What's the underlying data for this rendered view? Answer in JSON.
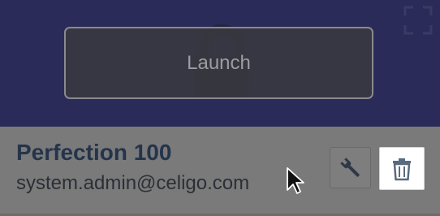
{
  "tile": {
    "launch_label": "Launch",
    "name": "Perfection 100",
    "user": "system.admin@celigo.com"
  },
  "icons": {
    "lock": "lock-icon",
    "expand": "expand-icon",
    "settings": "wrench-icon",
    "delete": "trash-icon",
    "cursor": "mouse-pointer-icon"
  },
  "colors": {
    "header_bg": "#2a2b58",
    "footer_bg": "#7a7a7a",
    "title_text": "#24344a",
    "delete_icon": "#5a6a7e"
  }
}
